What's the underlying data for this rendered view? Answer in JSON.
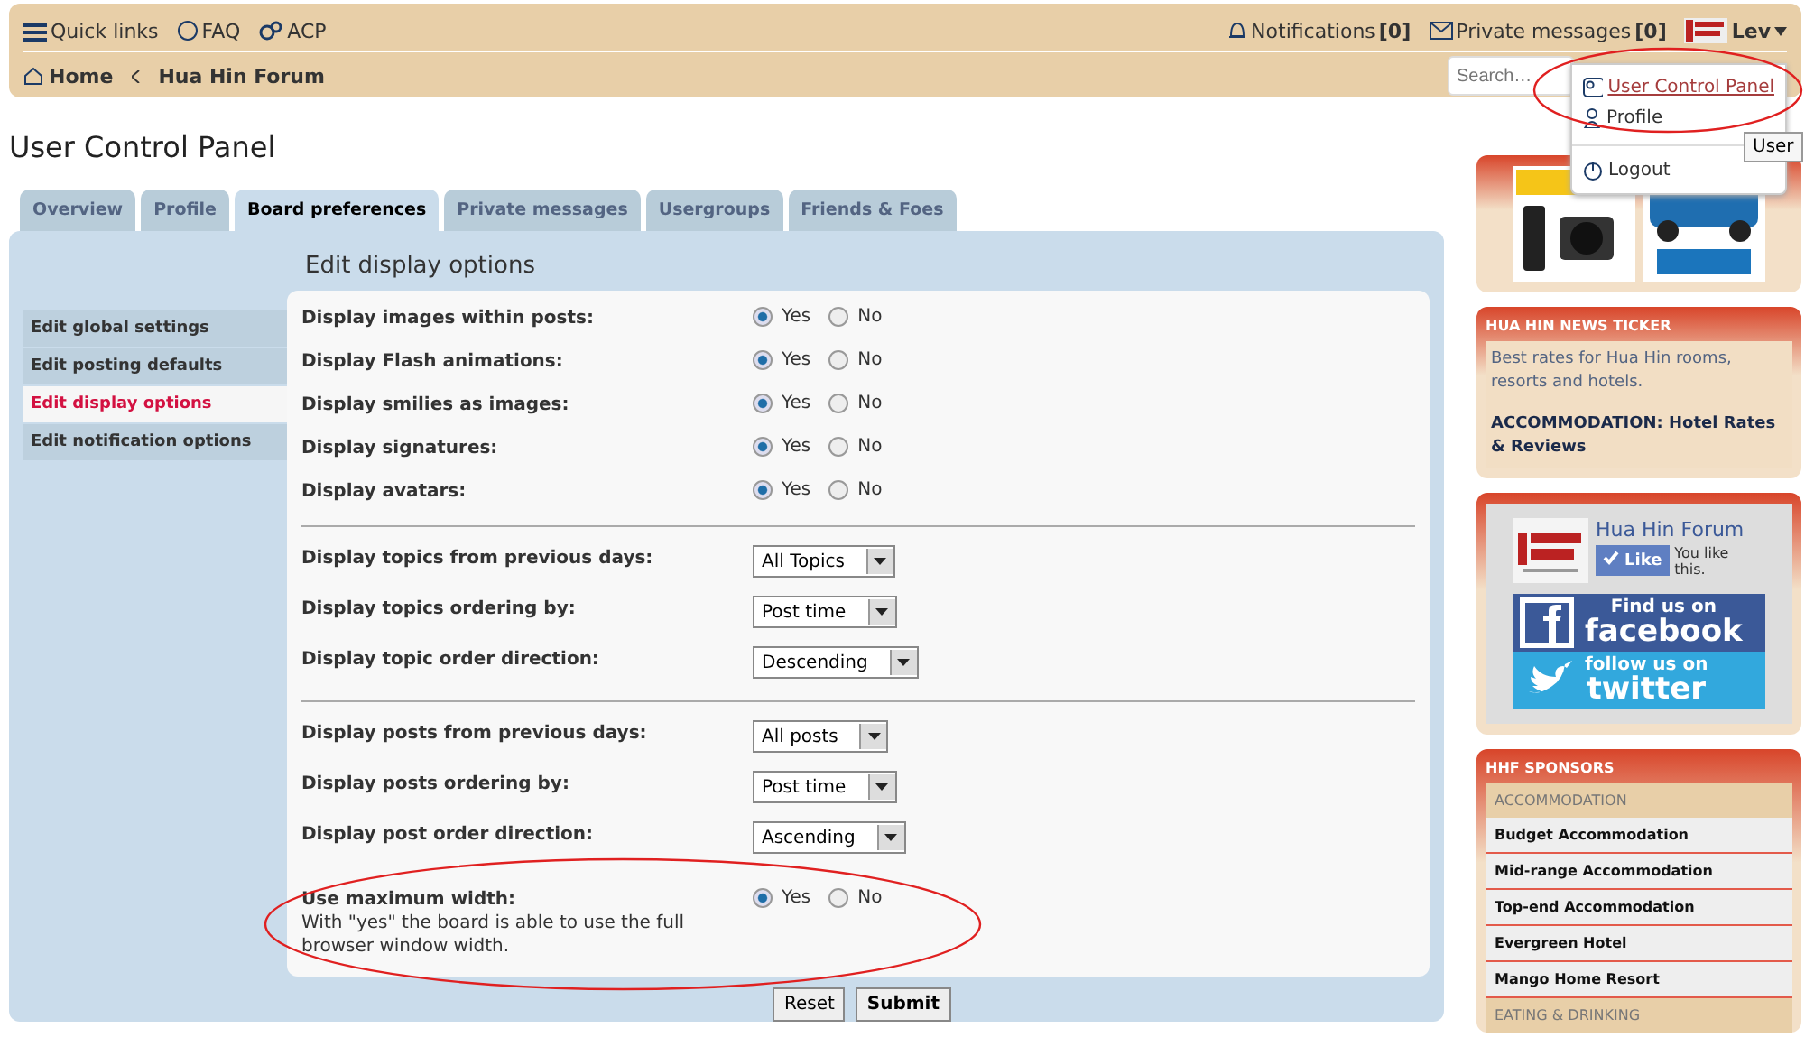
{
  "top_bar": {
    "left": [
      {
        "kind": "menu",
        "label": "Quick links"
      },
      {
        "kind": "faq",
        "label": "FAQ"
      },
      {
        "kind": "acp",
        "label": "ACP"
      }
    ],
    "notifications": {
      "label": "Notifications",
      "count": "[0]"
    },
    "messages": {
      "label": "Private messages",
      "count": "[0]"
    },
    "user": "Lev"
  },
  "breadcrumbs": [
    "Home",
    "Hua Hin Forum"
  ],
  "search": {
    "placeholder": "Search…"
  },
  "user_menu": [
    {
      "kind": "ucp",
      "label": "User Control Panel",
      "selected": true
    },
    {
      "kind": "profile",
      "label": "Profile",
      "selected": false
    },
    {
      "kind": "logout",
      "label": "Logout",
      "selected": false
    }
  ],
  "tooltip": "User",
  "page_title": "User Control Panel",
  "tabs": [
    {
      "label": "Overview",
      "selected": false
    },
    {
      "label": "Profile",
      "selected": false
    },
    {
      "label": "Board preferences",
      "selected": true
    },
    {
      "label": "Private messages",
      "selected": false
    },
    {
      "label": "Usergroups",
      "selected": false
    },
    {
      "label": "Friends & Foes",
      "selected": false
    }
  ],
  "section_title": "Edit display options",
  "side_nav": [
    {
      "label": "Edit global settings",
      "selected": false
    },
    {
      "label": "Edit posting defaults",
      "selected": false
    },
    {
      "label": "Edit display options",
      "selected": true
    },
    {
      "label": "Edit notification options",
      "selected": false
    }
  ],
  "groups": [
    {
      "settings": [
        {
          "kind": "radio",
          "label": "Display images within posts:",
          "options": [
            {
              "label": "Yes",
              "selected": true
            },
            {
              "label": "No",
              "selected": false
            }
          ]
        },
        {
          "kind": "radio",
          "label": "Display Flash animations:",
          "options": [
            {
              "label": "Yes",
              "selected": true
            },
            {
              "label": "No",
              "selected": false
            }
          ]
        },
        {
          "kind": "radio",
          "label": "Display smilies as images:",
          "options": [
            {
              "label": "Yes",
              "selected": true
            },
            {
              "label": "No",
              "selected": false
            }
          ]
        },
        {
          "kind": "radio",
          "label": "Display signatures:",
          "options": [
            {
              "label": "Yes",
              "selected": true
            },
            {
              "label": "No",
              "selected": false
            }
          ]
        },
        {
          "kind": "radio",
          "label": "Display avatars:",
          "options": [
            {
              "label": "Yes",
              "selected": true
            },
            {
              "label": "No",
              "selected": false
            }
          ]
        }
      ]
    },
    {
      "settings": [
        {
          "kind": "select",
          "label": "Display topics from previous days:",
          "value": "All Topics"
        },
        {
          "kind": "select",
          "label": "Display topics ordering by:",
          "value": "Post time"
        },
        {
          "kind": "select",
          "label": "Display topic order direction:",
          "value": "Descending"
        }
      ]
    },
    {
      "settings": [
        {
          "kind": "select",
          "label": "Display posts from previous days:",
          "value": "All posts"
        },
        {
          "kind": "select",
          "label": "Display posts ordering by:",
          "value": "Post time"
        },
        {
          "kind": "select",
          "label": "Display post order direction:",
          "value": "Ascending"
        },
        {
          "kind": "radio",
          "label": "Use maximum width:",
          "explain": "With \"yes\" the board is able to use the full browser window width.",
          "options": [
            {
              "label": "Yes",
              "selected": true
            },
            {
              "label": "No",
              "selected": false
            }
          ]
        }
      ]
    }
  ],
  "buttons": [
    {
      "label": "Reset",
      "kind": "secondary"
    },
    {
      "label": "Submit",
      "kind": "primary"
    }
  ],
  "sidebar": {
    "news": {
      "title": "HUA HIN NEWS TICKER",
      "text": "Best rates for Hua Hin rooms, resorts and hotels.",
      "link": "ACCOMMODATION: Hotel Rates & Reviews"
    },
    "social": {
      "page_name": "Hua Hin Forum",
      "like": "Like",
      "like_note": "You like this.",
      "facebook": [
        "Find us on",
        "facebook"
      ],
      "twitter": [
        "follow us on",
        "twitter"
      ]
    },
    "sponsors": {
      "title": "HHF SPONSORS",
      "items": [
        {
          "kind": "category",
          "label": "ACCOMMODATION"
        },
        {
          "kind": "link",
          "label": "Budget Accommodation"
        },
        {
          "kind": "link",
          "label": "Mid-range Accommodation"
        },
        {
          "kind": "link",
          "label": "Top-end Accommodation"
        },
        {
          "kind": "link",
          "label": "Evergreen Hotel"
        },
        {
          "kind": "link",
          "label": "Mango Home Resort"
        },
        {
          "kind": "category",
          "label": "EATING & DRINKING"
        }
      ]
    }
  }
}
